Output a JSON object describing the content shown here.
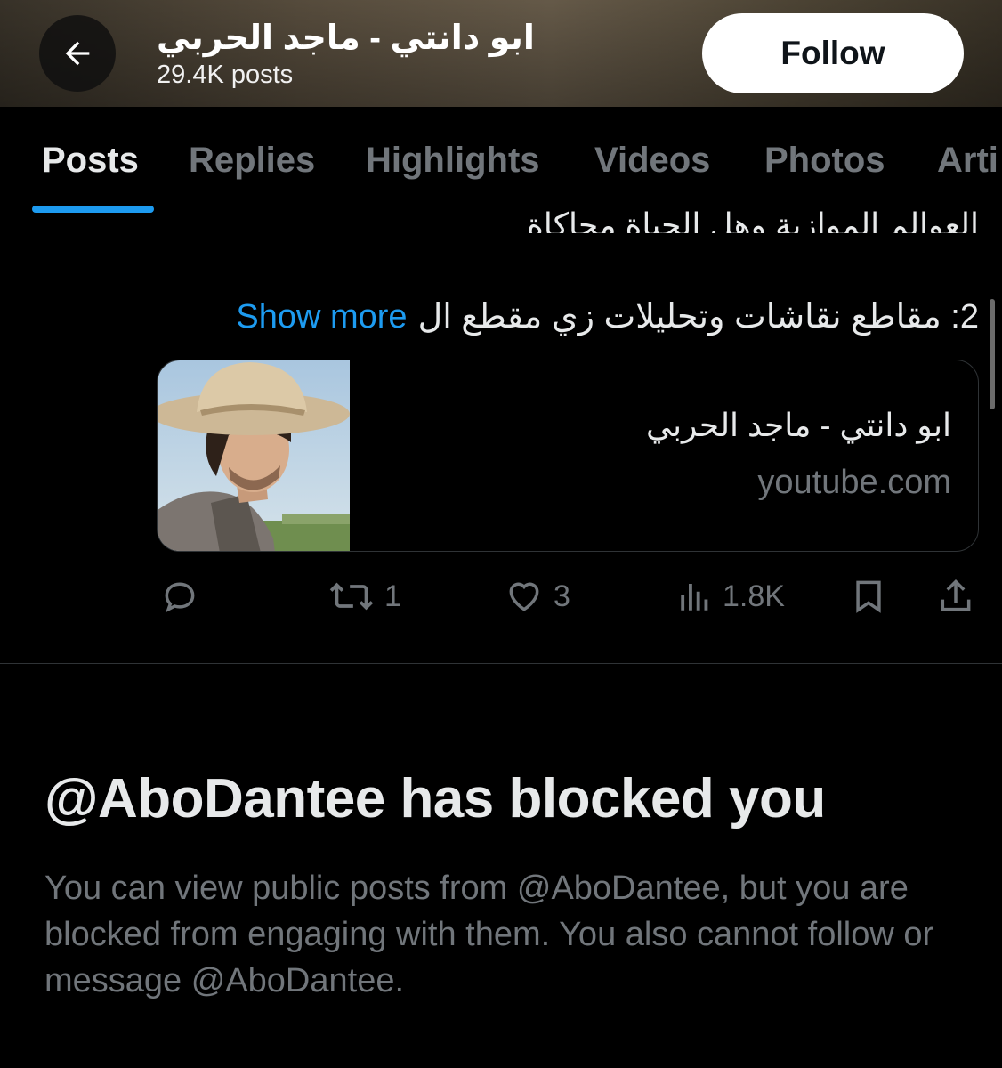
{
  "header": {
    "title": "ابو دانتي - ماجد الحربي",
    "post_count": "29.4K posts",
    "follow_label": "Follow"
  },
  "tabs": [
    {
      "label": "Posts",
      "active": true
    },
    {
      "label": "Replies",
      "active": false
    },
    {
      "label": "Highlights",
      "active": false
    },
    {
      "label": "Videos",
      "active": false
    },
    {
      "label": "Photos",
      "active": false
    },
    {
      "label": "Arti",
      "active": false
    }
  ],
  "post": {
    "clipped_line": "العوالم الموازية وهل الحياة محاكاة",
    "text": "2: مقاطع نقاشات وتحليلات زي مقطع ال",
    "show_more": "Show more",
    "link_card": {
      "title": "ابو دانتي - ماجد الحربي",
      "domain": "youtube.com"
    },
    "actions": {
      "reposts": "1",
      "likes": "3",
      "views": "1.8K"
    }
  },
  "blocked": {
    "title": "@AboDantee has blocked you",
    "body": "You can view public posts from @AboDantee, but you are blocked from engaging with them. You also cannot follow or message @AboDantee."
  },
  "colors": {
    "accent": "#1d9bf0",
    "text_primary": "#e7e9ea",
    "text_secondary": "#71767b",
    "background": "#000000"
  }
}
